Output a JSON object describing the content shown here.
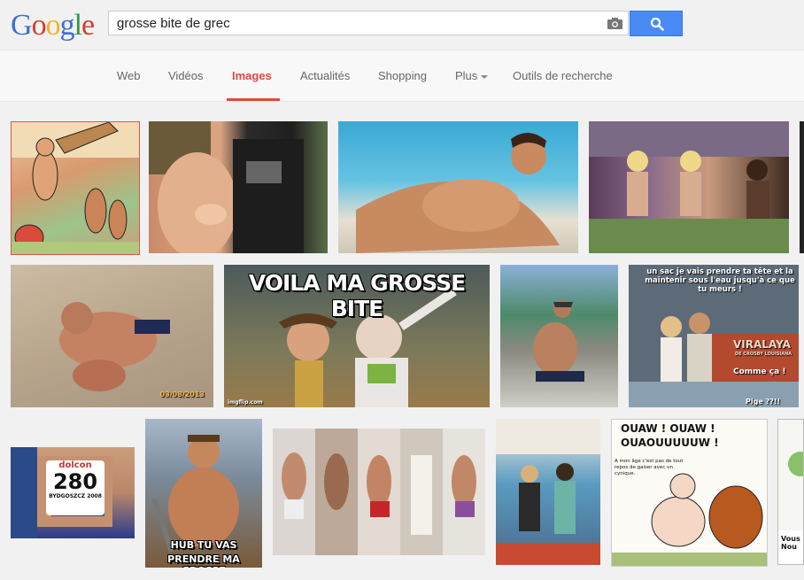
{
  "header": {
    "logo_letters": [
      "G",
      "o",
      "o",
      "g",
      "l",
      "e"
    ],
    "search_value": "grosse bite de grec",
    "camera_icon": "camera-icon",
    "search_icon": "search-icon"
  },
  "tabs": {
    "web": "Web",
    "videos": "Vidéos",
    "images": "Images",
    "actualites": "Actualités",
    "shopping": "Shopping",
    "plus": "Plus",
    "outils": "Outils de recherche",
    "active": "images",
    "accent_color": "#dd4b39"
  },
  "results": {
    "woody_caption": "VOILA MA GROSSE BITE",
    "boat_caption": "un sac je vais prendre ta tête et la maintenir sous l'eau jusqu'à ce que tu meurs !",
    "boat_caption_2": "Comme ça !",
    "boat_caption_3": "Pige ??!!",
    "boat_sign": "VIRALAYA",
    "boat_sign_2": "DE CROSBY LOUISIANA",
    "photo_date": "03/08/2013",
    "bib_brand": "dolcon",
    "bib_number": "280",
    "bib_city": "BYDGOSZCZ 2008",
    "hub_caption_1": "HUB TU VAS",
    "hub_caption_2": "PRENDRE MA GROSSE",
    "comic_title_1": "OUAW ! OUAW !",
    "comic_title_2": "OUAOUUUUUW !",
    "comic_box": "A mon âge c'est pas de tout repos de gaiser avec un cynique.",
    "comic_partial": "Vous Nou",
    "woody_watermark": "imgflip.com"
  }
}
